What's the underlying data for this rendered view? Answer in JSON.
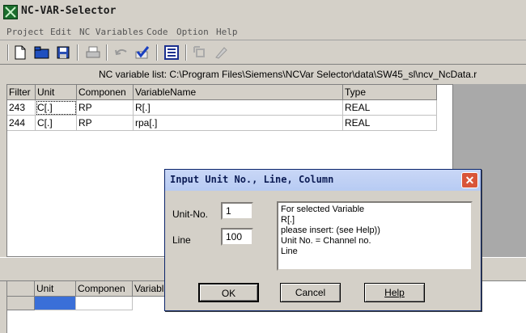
{
  "window": {
    "title": "NC-VAR-Selector"
  },
  "menu": [
    {
      "label": "Project"
    },
    {
      "label": "Edit"
    },
    {
      "label": "NC Variables"
    },
    {
      "label": "Code"
    },
    {
      "label": "Option"
    },
    {
      "label": "Help"
    }
  ],
  "toolbar": {
    "icons": [
      "new-file-icon",
      "open-folder-icon",
      "save-icon",
      "print-icon",
      "undo-icon",
      "check-icon",
      "list-icon",
      "select-icon",
      "edit-icon"
    ]
  },
  "path_label": "NC variable list:  C:\\Program Files\\Siemens\\NCVar Selector\\data\\SW45_sl\\ncv_NcData.r",
  "upper_table": {
    "headers": [
      "Filter",
      "Unit",
      "Componen",
      "VariableName",
      "Type"
    ],
    "rows": [
      [
        "243",
        "C[.]",
        "RP",
        "R[.]",
        "REAL"
      ],
      [
        "244",
        "C[.]",
        "RP",
        "rpa[.]",
        "REAL"
      ]
    ]
  },
  "lower_table": {
    "headers": [
      "Unit",
      "Componen",
      "Variable"
    ]
  },
  "dialog": {
    "title": "Input Unit No., Line, Column",
    "close": "✕",
    "unit_label": "Unit-No.",
    "unit_value": "1",
    "line_label": "Line",
    "line_value": "100",
    "info": [
      "For selected Variable",
      "R[.]",
      "please insert: (see Help))",
      "Unit No. = Channel no.",
      "Line"
    ],
    "ok": "OK",
    "cancel": "Cancel",
    "help": "Help"
  }
}
